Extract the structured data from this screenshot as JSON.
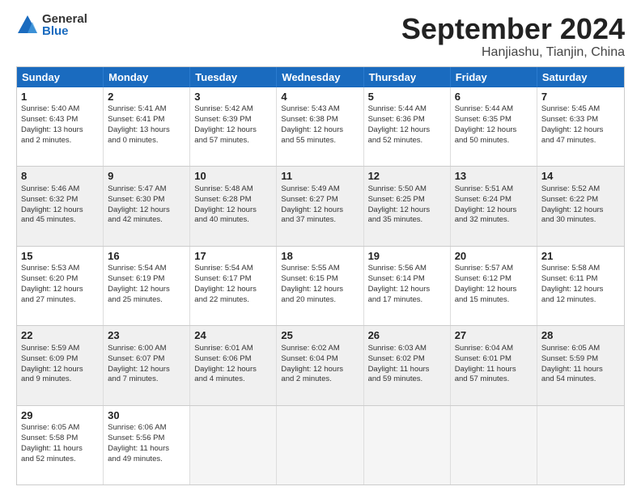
{
  "logo": {
    "general": "General",
    "blue": "Blue"
  },
  "title": "September 2024",
  "location": "Hanjiashu, Tianjin, China",
  "header_days": [
    "Sunday",
    "Monday",
    "Tuesday",
    "Wednesday",
    "Thursday",
    "Friday",
    "Saturday"
  ],
  "weeks": [
    [
      {
        "day": "1",
        "text": "Sunrise: 5:40 AM\nSunset: 6:43 PM\nDaylight: 13 hours\nand 2 minutes."
      },
      {
        "day": "2",
        "text": "Sunrise: 5:41 AM\nSunset: 6:41 PM\nDaylight: 13 hours\nand 0 minutes."
      },
      {
        "day": "3",
        "text": "Sunrise: 5:42 AM\nSunset: 6:39 PM\nDaylight: 12 hours\nand 57 minutes."
      },
      {
        "day": "4",
        "text": "Sunrise: 5:43 AM\nSunset: 6:38 PM\nDaylight: 12 hours\nand 55 minutes."
      },
      {
        "day": "5",
        "text": "Sunrise: 5:44 AM\nSunset: 6:36 PM\nDaylight: 12 hours\nand 52 minutes."
      },
      {
        "day": "6",
        "text": "Sunrise: 5:44 AM\nSunset: 6:35 PM\nDaylight: 12 hours\nand 50 minutes."
      },
      {
        "day": "7",
        "text": "Sunrise: 5:45 AM\nSunset: 6:33 PM\nDaylight: 12 hours\nand 47 minutes."
      }
    ],
    [
      {
        "day": "8",
        "text": "Sunrise: 5:46 AM\nSunset: 6:32 PM\nDaylight: 12 hours\nand 45 minutes."
      },
      {
        "day": "9",
        "text": "Sunrise: 5:47 AM\nSunset: 6:30 PM\nDaylight: 12 hours\nand 42 minutes."
      },
      {
        "day": "10",
        "text": "Sunrise: 5:48 AM\nSunset: 6:28 PM\nDaylight: 12 hours\nand 40 minutes."
      },
      {
        "day": "11",
        "text": "Sunrise: 5:49 AM\nSunset: 6:27 PM\nDaylight: 12 hours\nand 37 minutes."
      },
      {
        "day": "12",
        "text": "Sunrise: 5:50 AM\nSunset: 6:25 PM\nDaylight: 12 hours\nand 35 minutes."
      },
      {
        "day": "13",
        "text": "Sunrise: 5:51 AM\nSunset: 6:24 PM\nDaylight: 12 hours\nand 32 minutes."
      },
      {
        "day": "14",
        "text": "Sunrise: 5:52 AM\nSunset: 6:22 PM\nDaylight: 12 hours\nand 30 minutes."
      }
    ],
    [
      {
        "day": "15",
        "text": "Sunrise: 5:53 AM\nSunset: 6:20 PM\nDaylight: 12 hours\nand 27 minutes."
      },
      {
        "day": "16",
        "text": "Sunrise: 5:54 AM\nSunset: 6:19 PM\nDaylight: 12 hours\nand 25 minutes."
      },
      {
        "day": "17",
        "text": "Sunrise: 5:54 AM\nSunset: 6:17 PM\nDaylight: 12 hours\nand 22 minutes."
      },
      {
        "day": "18",
        "text": "Sunrise: 5:55 AM\nSunset: 6:15 PM\nDaylight: 12 hours\nand 20 minutes."
      },
      {
        "day": "19",
        "text": "Sunrise: 5:56 AM\nSunset: 6:14 PM\nDaylight: 12 hours\nand 17 minutes."
      },
      {
        "day": "20",
        "text": "Sunrise: 5:57 AM\nSunset: 6:12 PM\nDaylight: 12 hours\nand 15 minutes."
      },
      {
        "day": "21",
        "text": "Sunrise: 5:58 AM\nSunset: 6:11 PM\nDaylight: 12 hours\nand 12 minutes."
      }
    ],
    [
      {
        "day": "22",
        "text": "Sunrise: 5:59 AM\nSunset: 6:09 PM\nDaylight: 12 hours\nand 9 minutes."
      },
      {
        "day": "23",
        "text": "Sunrise: 6:00 AM\nSunset: 6:07 PM\nDaylight: 12 hours\nand 7 minutes."
      },
      {
        "day": "24",
        "text": "Sunrise: 6:01 AM\nSunset: 6:06 PM\nDaylight: 12 hours\nand 4 minutes."
      },
      {
        "day": "25",
        "text": "Sunrise: 6:02 AM\nSunset: 6:04 PM\nDaylight: 12 hours\nand 2 minutes."
      },
      {
        "day": "26",
        "text": "Sunrise: 6:03 AM\nSunset: 6:02 PM\nDaylight: 11 hours\nand 59 minutes."
      },
      {
        "day": "27",
        "text": "Sunrise: 6:04 AM\nSunset: 6:01 PM\nDaylight: 11 hours\nand 57 minutes."
      },
      {
        "day": "28",
        "text": "Sunrise: 6:05 AM\nSunset: 5:59 PM\nDaylight: 11 hours\nand 54 minutes."
      }
    ],
    [
      {
        "day": "29",
        "text": "Sunrise: 6:05 AM\nSunset: 5:58 PM\nDaylight: 11 hours\nand 52 minutes."
      },
      {
        "day": "30",
        "text": "Sunrise: 6:06 AM\nSunset: 5:56 PM\nDaylight: 11 hours\nand 49 minutes."
      },
      {
        "day": "",
        "text": "",
        "empty": true
      },
      {
        "day": "",
        "text": "",
        "empty": true
      },
      {
        "day": "",
        "text": "",
        "empty": true
      },
      {
        "day": "",
        "text": "",
        "empty": true
      },
      {
        "day": "",
        "text": "",
        "empty": true
      }
    ]
  ]
}
